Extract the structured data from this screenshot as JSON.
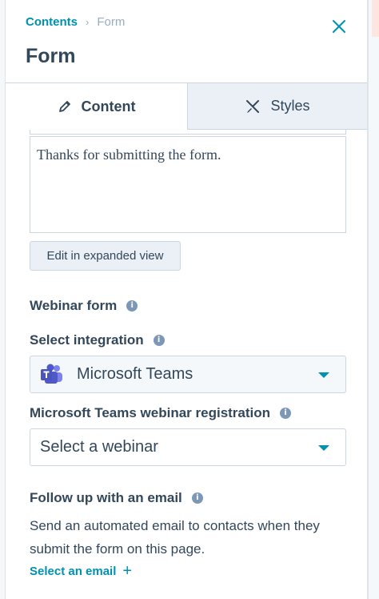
{
  "breadcrumb": {
    "parent": "Contents",
    "separator": "›",
    "current": "Form"
  },
  "header": {
    "title": "Form"
  },
  "tabs": [
    {
      "label": "Content",
      "icon": "pencil-icon",
      "active": true
    },
    {
      "label": "Styles",
      "icon": "paint-brush-icon",
      "active": false
    }
  ],
  "editor": {
    "text": "Thanks for submitting the form."
  },
  "expand_button": "Edit in expanded view",
  "webinar_form": {
    "label": "Webinar form"
  },
  "integration": {
    "label": "Select integration",
    "value": "Microsoft Teams",
    "icon": "microsoft-teams-icon"
  },
  "webinar_registration": {
    "label": "Microsoft Teams webinar registration",
    "placeholder": "Select a webinar"
  },
  "follow_up": {
    "label": "Follow up with an email",
    "description": "Send an automated email to contacts when they submit the form on this page.",
    "action": "Select an email",
    "action_icon": "+"
  },
  "colors": {
    "accent": "#0091ae",
    "text": "#33475b",
    "border": "#cbd6e2",
    "teams": "#5059c9"
  }
}
